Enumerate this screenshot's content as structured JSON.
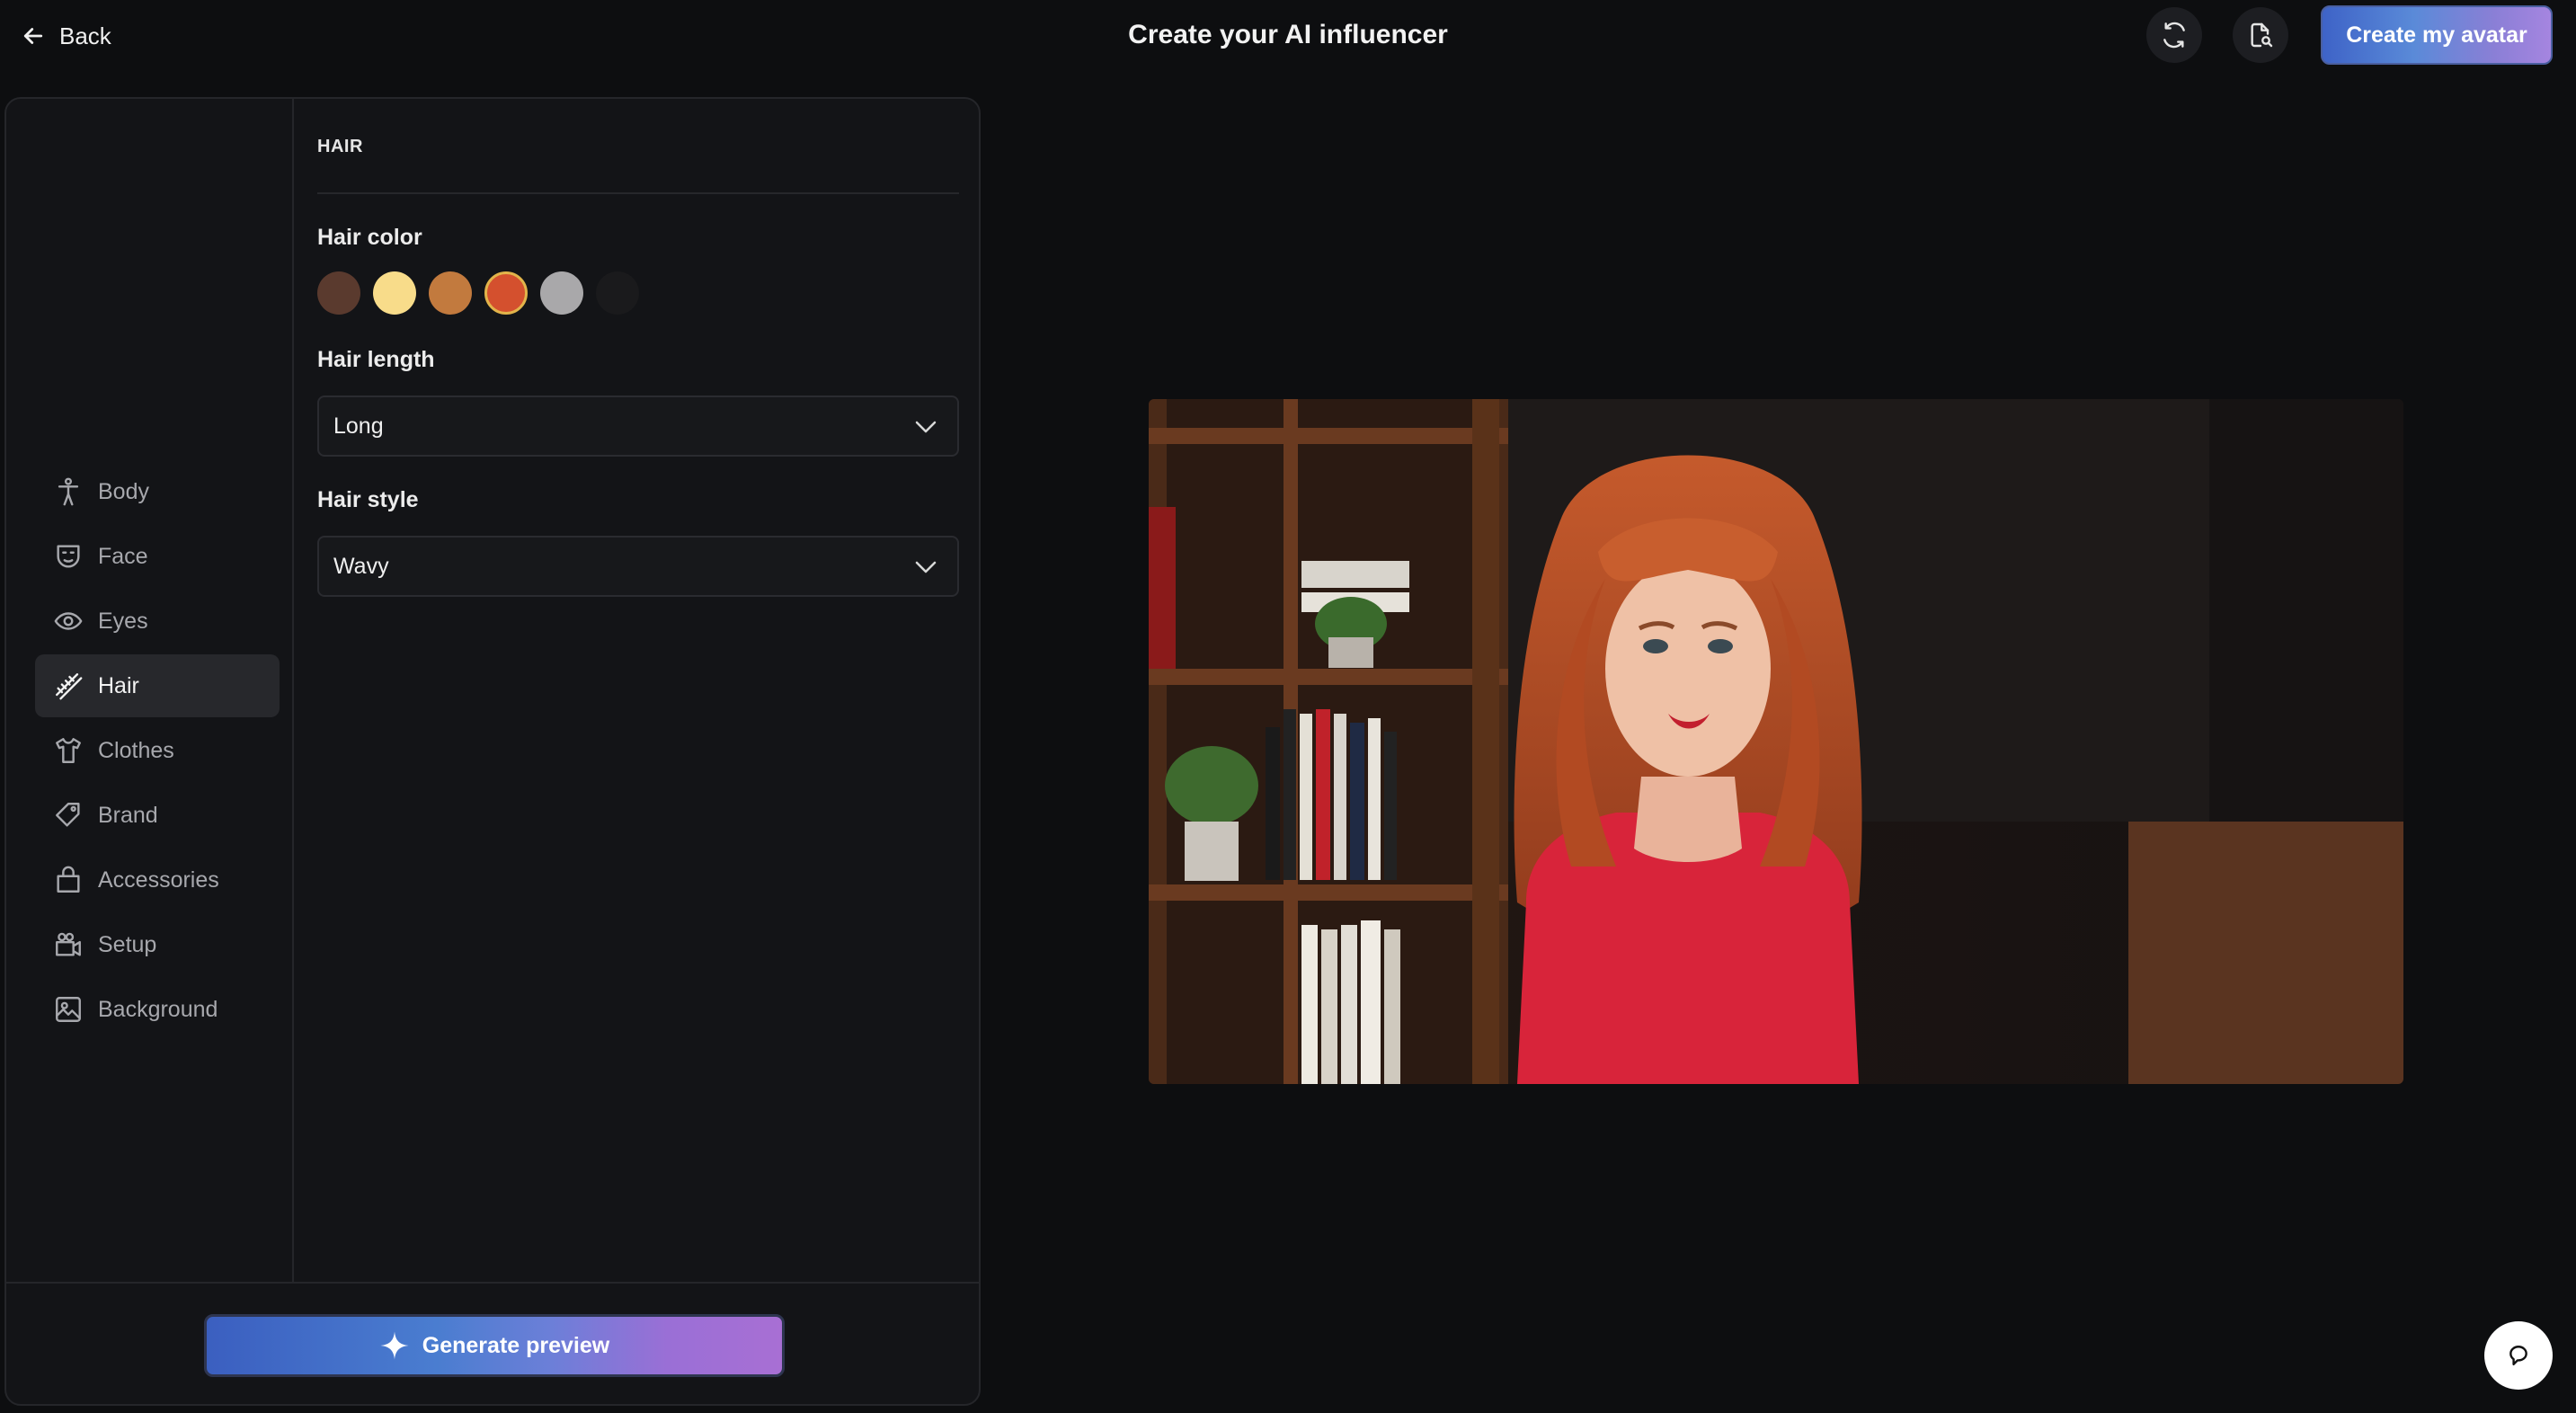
{
  "header": {
    "back_label": "Back",
    "title": "Create your AI influencer",
    "create_label": "Create my avatar"
  },
  "sidebar": {
    "items": [
      {
        "label": "Body",
        "icon": "body-icon"
      },
      {
        "label": "Face",
        "icon": "face-icon"
      },
      {
        "label": "Eyes",
        "icon": "eye-icon"
      },
      {
        "label": "Hair",
        "icon": "hair-icon",
        "active": true
      },
      {
        "label": "Clothes",
        "icon": "shirt-icon"
      },
      {
        "label": "Brand",
        "icon": "tag-icon"
      },
      {
        "label": "Accessories",
        "icon": "bag-icon"
      },
      {
        "label": "Setup",
        "icon": "camera-icon"
      },
      {
        "label": "Background",
        "icon": "image-icon"
      }
    ]
  },
  "hair": {
    "section_title": "HAIR",
    "color_label": "Hair color",
    "colors": [
      "#5a3a2e",
      "#f8dc8a",
      "#c27a3e",
      "#d4502e",
      "#a9a8aa",
      "#1a1a1c"
    ],
    "selected_color_index": 3,
    "length_label": "Hair length",
    "length_value": "Long",
    "style_label": "Hair style",
    "style_value": "Wavy"
  },
  "footer": {
    "generate_label": "Generate preview"
  },
  "colors": {
    "background": "#0d0e10",
    "panel": "#131417",
    "accent_start": "#3e63c7",
    "accent_end": "#a585e0"
  }
}
